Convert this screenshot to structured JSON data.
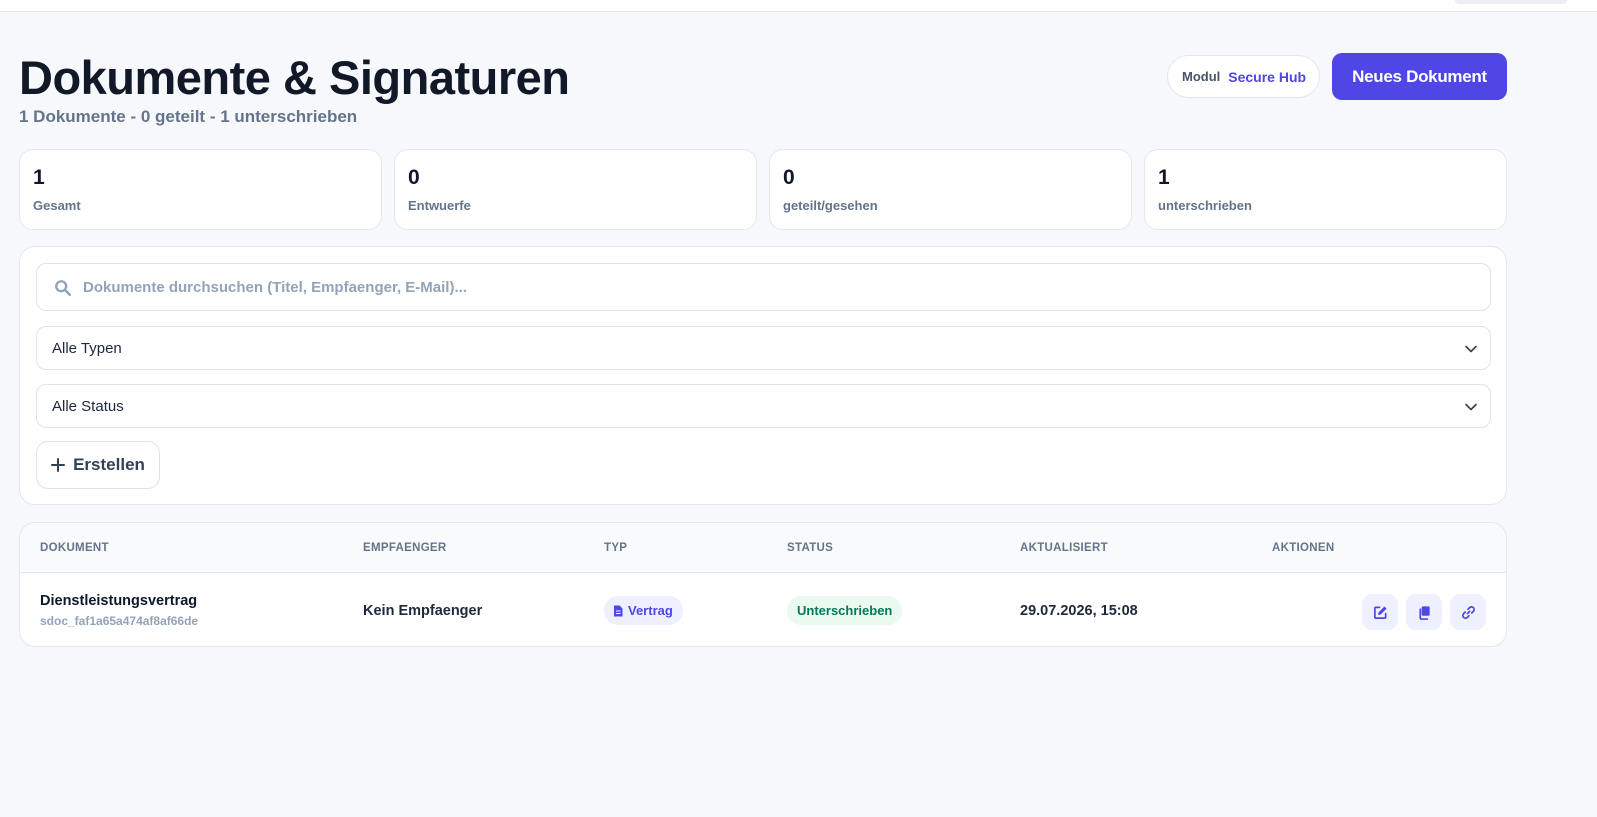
{
  "header": {
    "title": "Dokumente & Signaturen",
    "subtitle": "1 Dokumente - 0 geteilt - 1 unterschrieben",
    "modul_label": "Modul",
    "modul_value": "Secure Hub",
    "new_document_label": "Neues Dokument"
  },
  "stats": [
    {
      "value": "1",
      "label": "Gesamt"
    },
    {
      "value": "0",
      "label": "Entwuerfe"
    },
    {
      "value": "0",
      "label": "geteilt/gesehen"
    },
    {
      "value": "1",
      "label": "unterschrieben"
    }
  ],
  "filters": {
    "search_placeholder": "Dokumente durchsuchen (Titel, Empfaenger, E-Mail)...",
    "search_value": "",
    "type_selected": "Alle Typen",
    "status_selected": "Alle Status",
    "create_label": "Erstellen"
  },
  "table": {
    "columns": [
      "DOKUMENT",
      "EMPFAENGER",
      "TYP",
      "STATUS",
      "AKTUALISIERT",
      "AKTIONEN"
    ],
    "rows": [
      {
        "title": "Dienstleistungsvertrag",
        "id": "sdoc_faf1a65a474af8af66de",
        "recipient": "Kein Empfaenger",
        "type": "Vertrag",
        "status": "Unterschrieben",
        "updated": "29.07.2026, 15:08",
        "actions": [
          "edit-icon",
          "copy-icon",
          "link-icon"
        ]
      }
    ]
  },
  "colors": {
    "accent": "#4f46e5",
    "status_signed_text": "#047857",
    "status_signed_bg": "#eafaf1",
    "background": "#f7f8fb"
  }
}
